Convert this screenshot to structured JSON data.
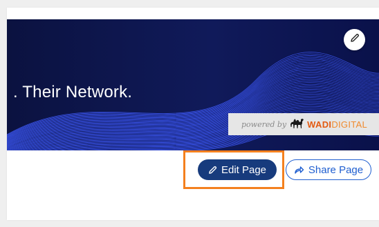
{
  "banner": {
    "tagline": ". Their Network.",
    "edit_icon": "pencil-icon",
    "powered_by": {
      "prefix": "powered by",
      "brand_strong": "WADI",
      "brand_light": "DIGITAL",
      "logo_icon": "camel-icon"
    }
  },
  "actions": {
    "edit_page_label": "Edit Page",
    "edit_page_icon": "pencil-icon",
    "share_page_label": "Share Page",
    "share_page_icon": "share-arrow-icon"
  },
  "colors": {
    "banner_bg": "#101a5a",
    "wave_line": "#3f5bff",
    "edit_button": "#173b7d",
    "share_border": "#1f5ed0",
    "highlight": "#f4801e",
    "brand_orange": "#e35b12"
  }
}
